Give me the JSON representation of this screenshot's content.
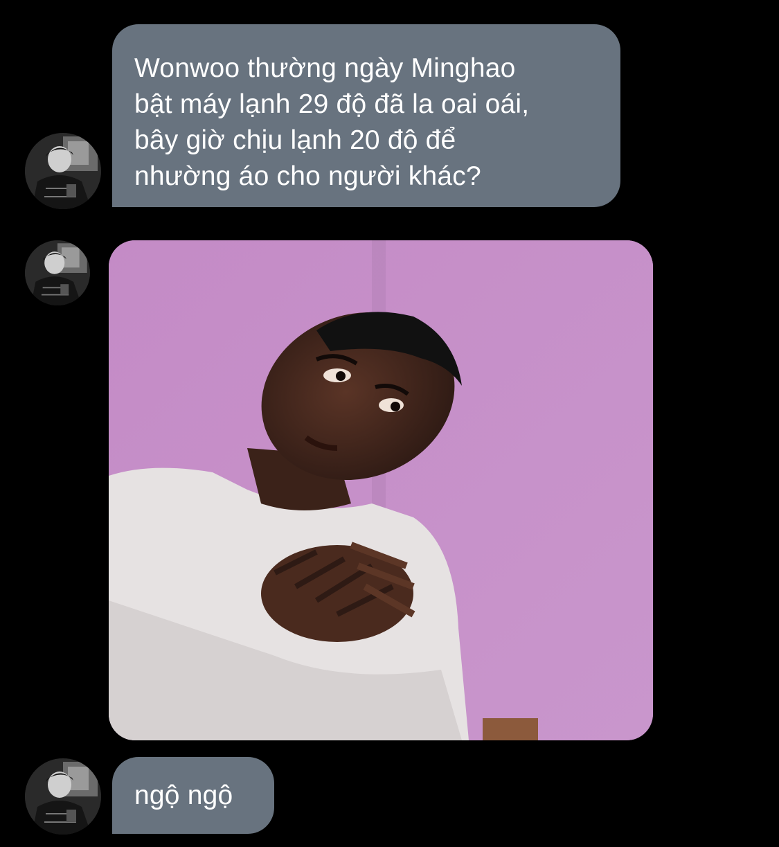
{
  "conversation": {
    "messages": [
      {
        "type": "text",
        "text": "Wonwoo thường ngày Minghao\nbật máy lạnh 29 độ đã la oai oái,\nbây giờ chịu lạnh 20 độ để\nnhường áo cho người khác?"
      },
      {
        "type": "image",
        "image_description": "meme-reaction-photo"
      },
      {
        "type": "text",
        "text": "ngộ ngộ"
      }
    ]
  },
  "colors": {
    "background": "#000000",
    "bubble": "#68737f",
    "bubble_text": "#ffffff",
    "image_wall": "#c38fc6"
  }
}
